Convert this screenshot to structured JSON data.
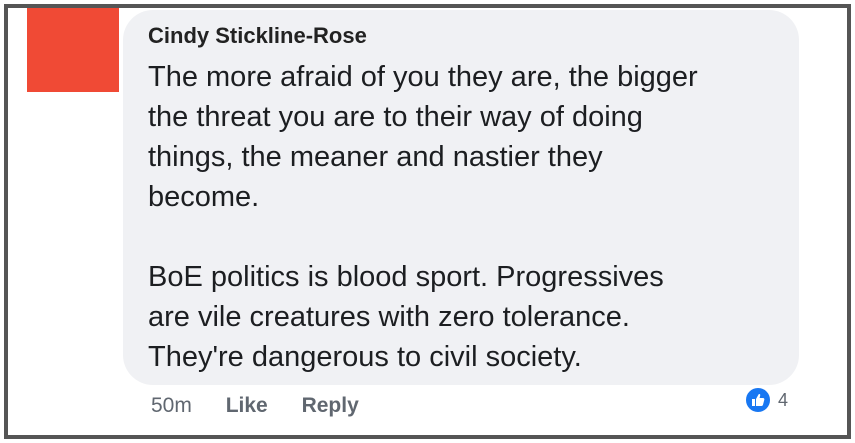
{
  "comment": {
    "author": "Cindy Stickline-Rose",
    "paragraph1": [
      "The more afraid of you they are, the bigger",
      "the threat you are to their way of doing",
      "things, the meaner and nastier they",
      "become."
    ],
    "paragraph2": [
      "BoE politics is blood sport.  Progressives",
      "are vile creatures with zero tolerance.",
      "They're dangerous to civil society."
    ]
  },
  "actions": {
    "time": "50m",
    "like_label": "Like",
    "reply_label": "Reply"
  },
  "reactions": {
    "icon": "like-icon",
    "count": "4",
    "color": "#1877f2"
  },
  "colors": {
    "avatar": "#f04a35",
    "bubble": "#f0f1f4",
    "frame_border": "#555555"
  }
}
